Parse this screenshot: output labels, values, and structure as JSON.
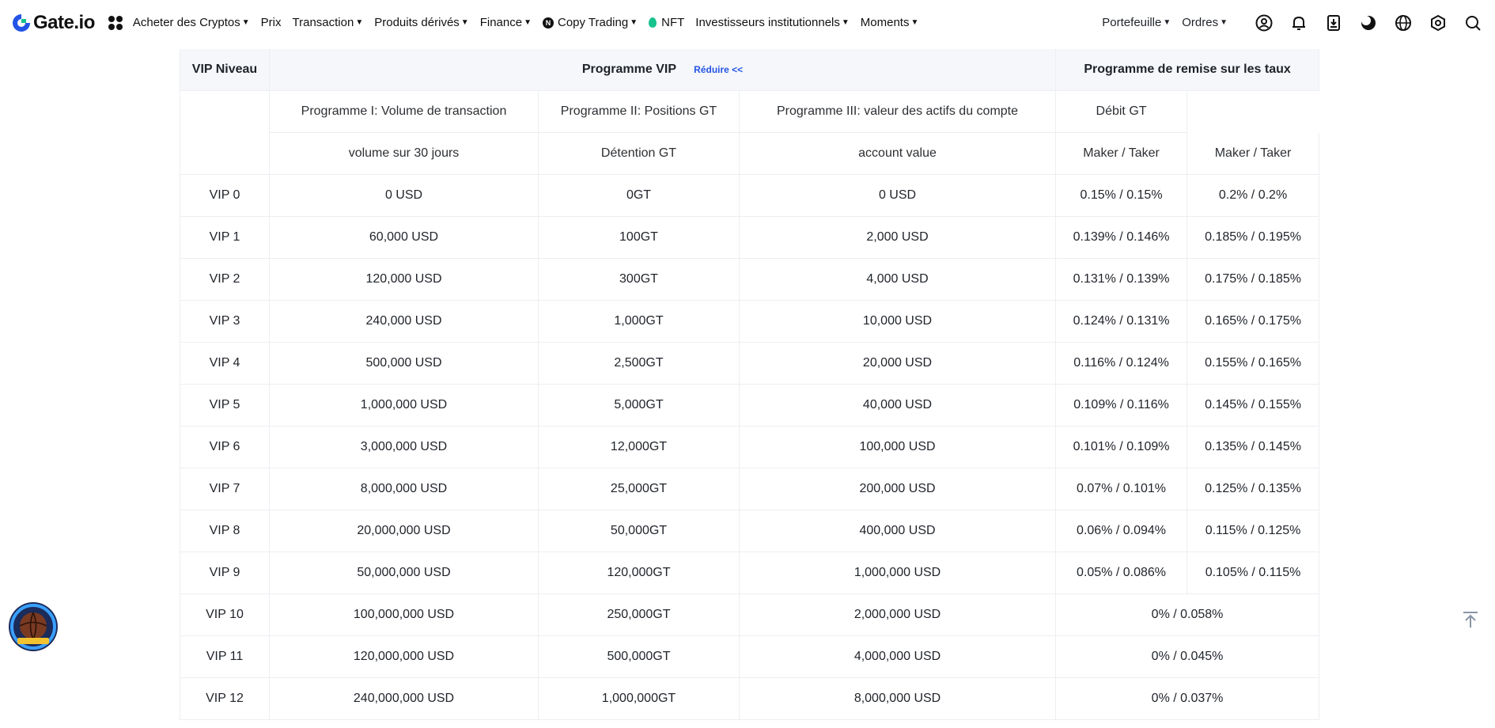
{
  "nav": {
    "brand": "Gate.io",
    "items": [
      {
        "label": "Acheter des Cryptos",
        "caret": true
      },
      {
        "label": "Prix",
        "caret": false
      },
      {
        "label": "Transaction",
        "caret": true
      },
      {
        "label": "Produits dérivés",
        "caret": true
      },
      {
        "label": "Finance",
        "caret": true
      },
      {
        "label": "Copy Trading",
        "caret": true
      },
      {
        "label": "NFT",
        "caret": false
      },
      {
        "label": "Investisseurs institutionnels",
        "caret": true
      },
      {
        "label": "Moments",
        "caret": true
      }
    ],
    "right": {
      "wallet": "Portefeuille",
      "orders": "Ordres"
    },
    "right_icons": [
      "user-icon",
      "bell-icon",
      "download-icon",
      "theme-icon",
      "globe-icon",
      "settings-icon",
      "search-icon"
    ]
  },
  "table": {
    "head": {
      "vip_level": "VIP Niveau",
      "vip_program": "Programme VIP",
      "collapse": "Réduire <<",
      "rebate_program": "Programme de remise sur les taux"
    },
    "programs": {
      "p1": "Programme I: Volume de transaction",
      "p2": "Programme II: Positions GT",
      "p3": "Programme III: valeur des actifs du compte",
      "gt_debit": "Débit GT"
    },
    "sub": {
      "volume": "volume sur 30 jours",
      "holding": "Détention GT",
      "account": "account value",
      "maker_taker_1": "Maker / Taker",
      "maker_taker_2": "Maker / Taker"
    },
    "rows": [
      {
        "level": "VIP 0",
        "volume": "0 USD",
        "gt": "0GT",
        "account": "0 USD",
        "fee_gt": "0.15% / 0.15%",
        "fee": "0.2% / 0.2%"
      },
      {
        "level": "VIP 1",
        "volume": "60,000 USD",
        "gt": "100GT",
        "account": "2,000 USD",
        "fee_gt": "0.139% / 0.146%",
        "fee": "0.185% / 0.195%"
      },
      {
        "level": "VIP 2",
        "volume": "120,000 USD",
        "gt": "300GT",
        "account": "4,000 USD",
        "fee_gt": "0.131% / 0.139%",
        "fee": "0.175% / 0.185%"
      },
      {
        "level": "VIP 3",
        "volume": "240,000 USD",
        "gt": "1,000GT",
        "account": "10,000 USD",
        "fee_gt": "0.124% / 0.131%",
        "fee": "0.165% / 0.175%"
      },
      {
        "level": "VIP 4",
        "volume": "500,000 USD",
        "gt": "2,500GT",
        "account": "20,000 USD",
        "fee_gt": "0.116% / 0.124%",
        "fee": "0.155% / 0.165%"
      },
      {
        "level": "VIP 5",
        "volume": "1,000,000 USD",
        "gt": "5,000GT",
        "account": "40,000 USD",
        "fee_gt": "0.109% / 0.116%",
        "fee": "0.145% / 0.155%"
      },
      {
        "level": "VIP 6",
        "volume": "3,000,000 USD",
        "gt": "12,000GT",
        "account": "100,000 USD",
        "fee_gt": "0.101% / 0.109%",
        "fee": "0.135% / 0.145%"
      },
      {
        "level": "VIP 7",
        "volume": "8,000,000 USD",
        "gt": "25,000GT",
        "account": "200,000 USD",
        "fee_gt": "0.07% / 0.101%",
        "fee": "0.125% / 0.135%"
      },
      {
        "level": "VIP 8",
        "volume": "20,000,000 USD",
        "gt": "50,000GT",
        "account": "400,000 USD",
        "fee_gt": "0.06% / 0.094%",
        "fee": "0.115% / 0.125%"
      },
      {
        "level": "VIP 9",
        "volume": "50,000,000 USD",
        "gt": "120,000GT",
        "account": "1,000,000 USD",
        "fee_gt": "0.05% / 0.086%",
        "fee": "0.105% / 0.115%"
      },
      {
        "level": "VIP 10",
        "volume": "100,000,000 USD",
        "gt": "250,000GT",
        "account": "2,000,000 USD",
        "fee_merged": "0% / 0.058%"
      },
      {
        "level": "VIP 11",
        "volume": "120,000,000 USD",
        "gt": "500,000GT",
        "account": "4,000,000 USD",
        "fee_merged": "0% / 0.045%"
      },
      {
        "level": "VIP 12",
        "volume": "240,000,000 USD",
        "gt": "1,000,000GT",
        "account": "8,000,000 USD",
        "fee_merged": "0% / 0.037%"
      }
    ]
  },
  "badge": {
    "lettering": "NBA CHAMPIONS",
    "amount": "$10,000"
  },
  "colors": {
    "accent_blue": "#2354e6",
    "header_bg": "#f5f7fa",
    "border": "#eceef1",
    "nft_green": "#17c28d"
  }
}
